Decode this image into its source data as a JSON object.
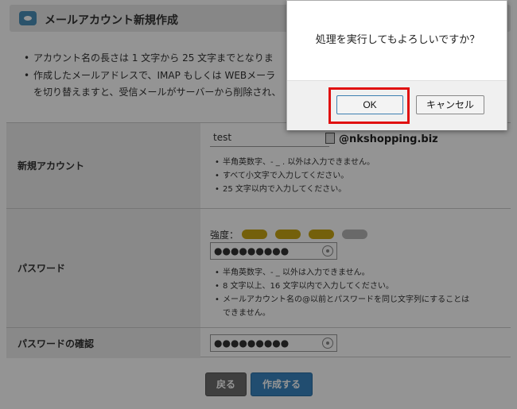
{
  "header": {
    "title": "メールアカウント新規作成"
  },
  "notes": [
    "アカウント名の長さは 1 文字から 25 文字までとなりま",
    "作成したメールアドレスで、IMAP もしくは WEBメーラ",
    "を切り替えますと、受信メールがサーバーから削除され、"
  ],
  "form": {
    "account": {
      "label": "新規アカウント",
      "value": "test",
      "domain": "@nkshopping.biz",
      "hints": [
        "半角英数字、- _ . 以外は入力できません。",
        "すべて小文字で入力してください。",
        "25 文字以内で入力してください。"
      ]
    },
    "password": {
      "label": "パスワード",
      "strength_label": "強度：",
      "strength": {
        "filled": 3,
        "total": 4
      },
      "value": "●●●●●●●●●",
      "hints": [
        "半角英数字、- _ 以外は入力できません。",
        "8 文字以上、16 文字以内で入力してください。",
        "メールアカウント名の@以前とパスワードを同じ文字列にすることは",
        "できません。"
      ]
    },
    "confirm": {
      "label": "パスワードの確認",
      "value": "●●●●●●●●●"
    }
  },
  "actions": {
    "back": "戻る",
    "create": "作成する"
  },
  "dialog": {
    "message": "処理を実行してもよろしいですか？",
    "ok": "OK",
    "cancel": "キャンセル"
  },
  "colors": {
    "highlight": "#e01010",
    "create_button": "#3a86c2",
    "strength_on": "#c9a514",
    "strength_off": "#b5b5b5"
  }
}
